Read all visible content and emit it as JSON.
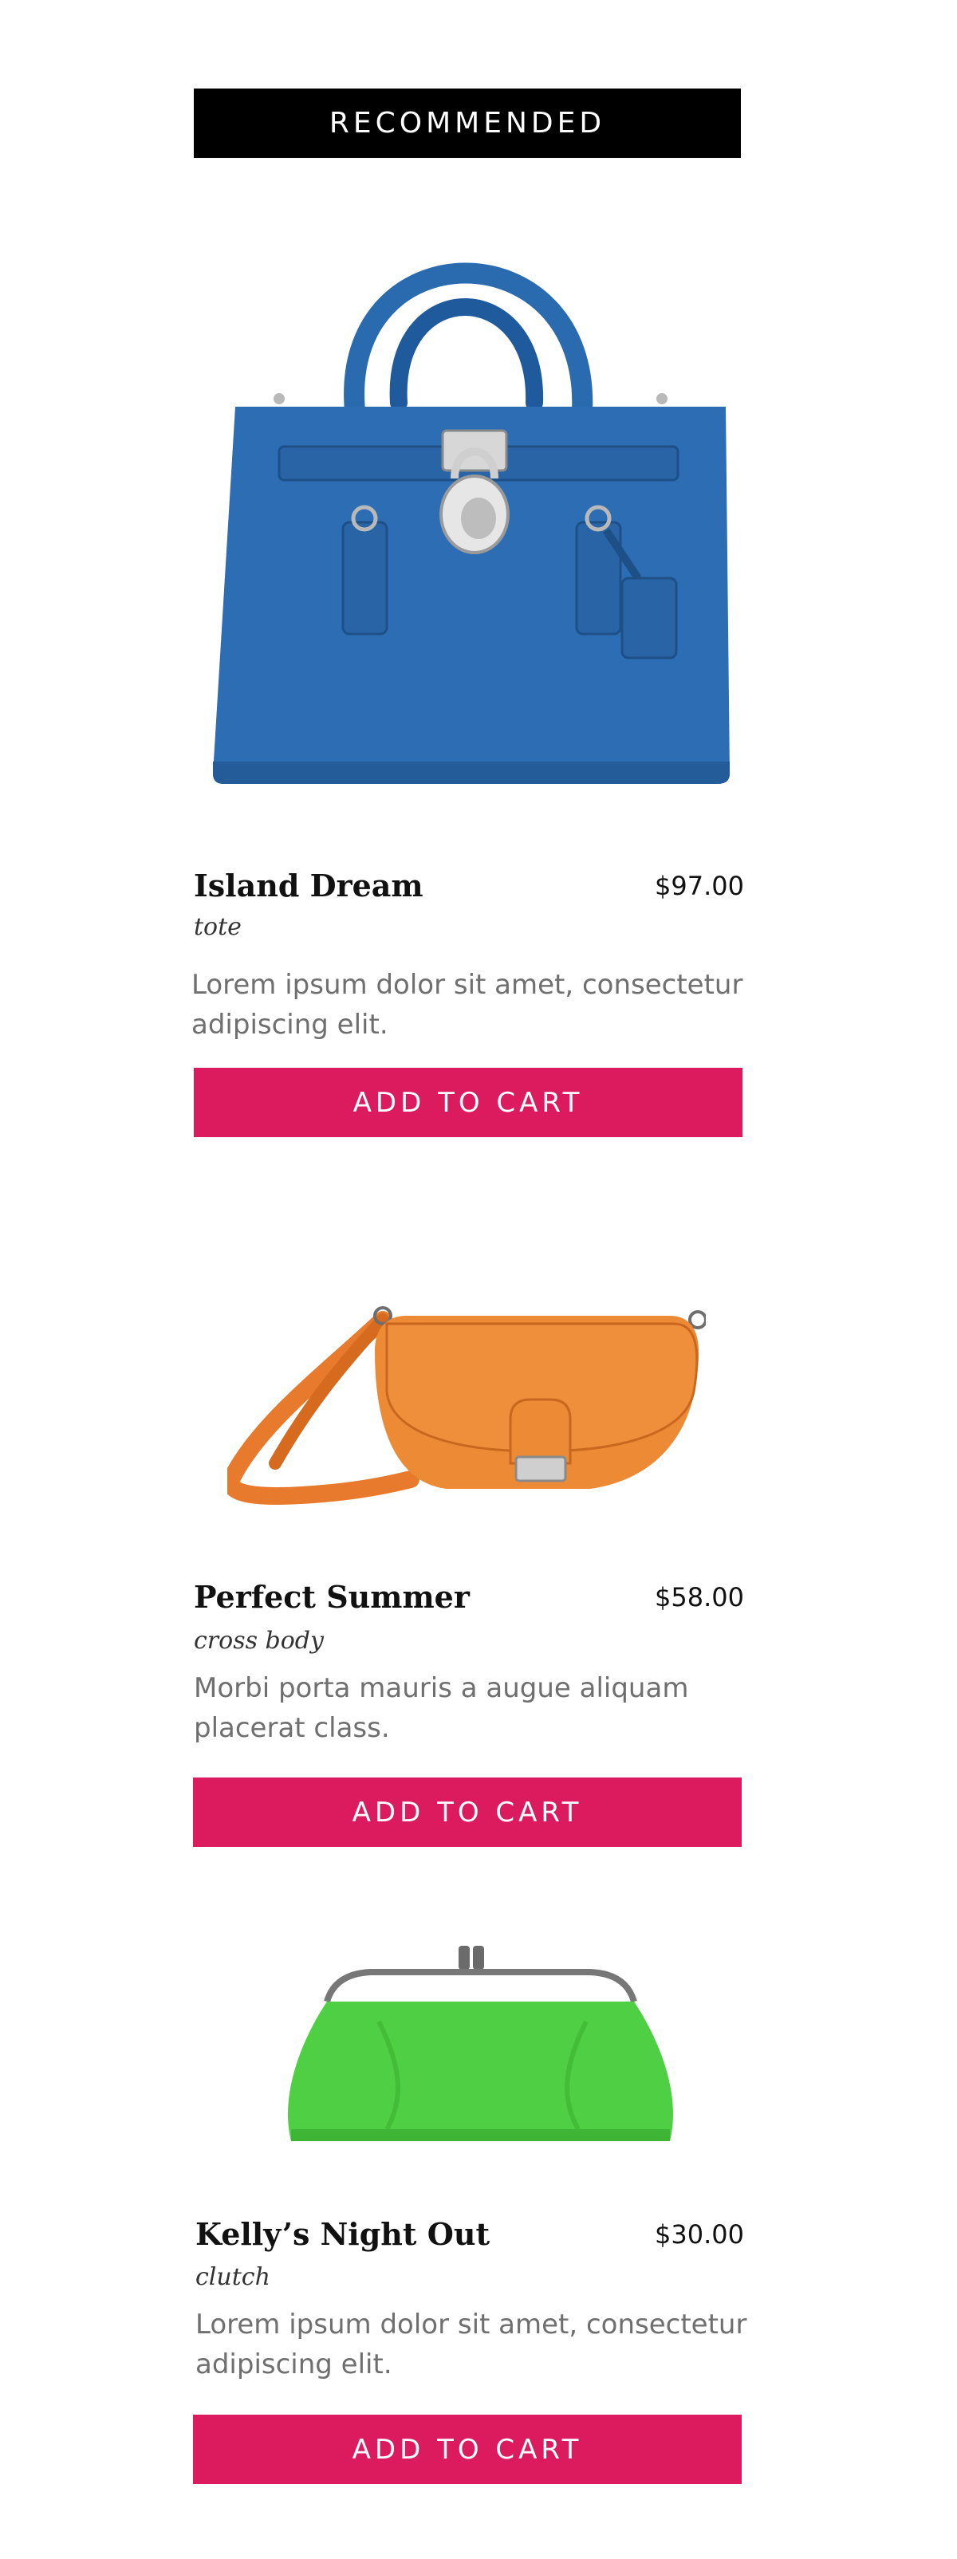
{
  "header": {
    "title": "RECOMMENDED"
  },
  "colors": {
    "accent": "#dc1b5e",
    "header_bg": "#000000"
  },
  "products": [
    {
      "name": "Island Dream",
      "price": "$97.00",
      "category": "tote",
      "description": "Lorem ipsum dolor sit amet, consectetur adipiscing elit.",
      "button": "ADD TO CART",
      "image": "blue-tote-handbag"
    },
    {
      "name": "Perfect Summer",
      "price": "$58.00",
      "category": "cross body",
      "description": "Morbi porta mauris a augue aliquam placerat class.",
      "button": "ADD TO CART",
      "image": "orange-crossbody-bag"
    },
    {
      "name": "Kelly’s Night Out",
      "price": "$30.00",
      "category": "clutch",
      "description": "Lorem ipsum dolor sit amet, consectetur adipiscing elit.",
      "button": "ADD TO CART",
      "image": "green-clutch-purse"
    }
  ]
}
